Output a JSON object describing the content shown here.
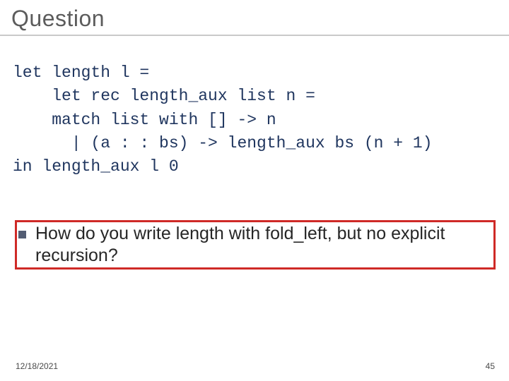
{
  "title": "Question",
  "code": {
    "l1": "let length l =",
    "l2": "    let rec length_aux list n =",
    "l3": "    match list with [] -> n",
    "l4": "      | (a : : bs) -> length_aux bs (n + 1)",
    "l5": "in length_aux l 0"
  },
  "question": "How do you write length with fold_left, but no explicit recursion?",
  "footer": {
    "date": "12/18/2021",
    "page": "45"
  }
}
